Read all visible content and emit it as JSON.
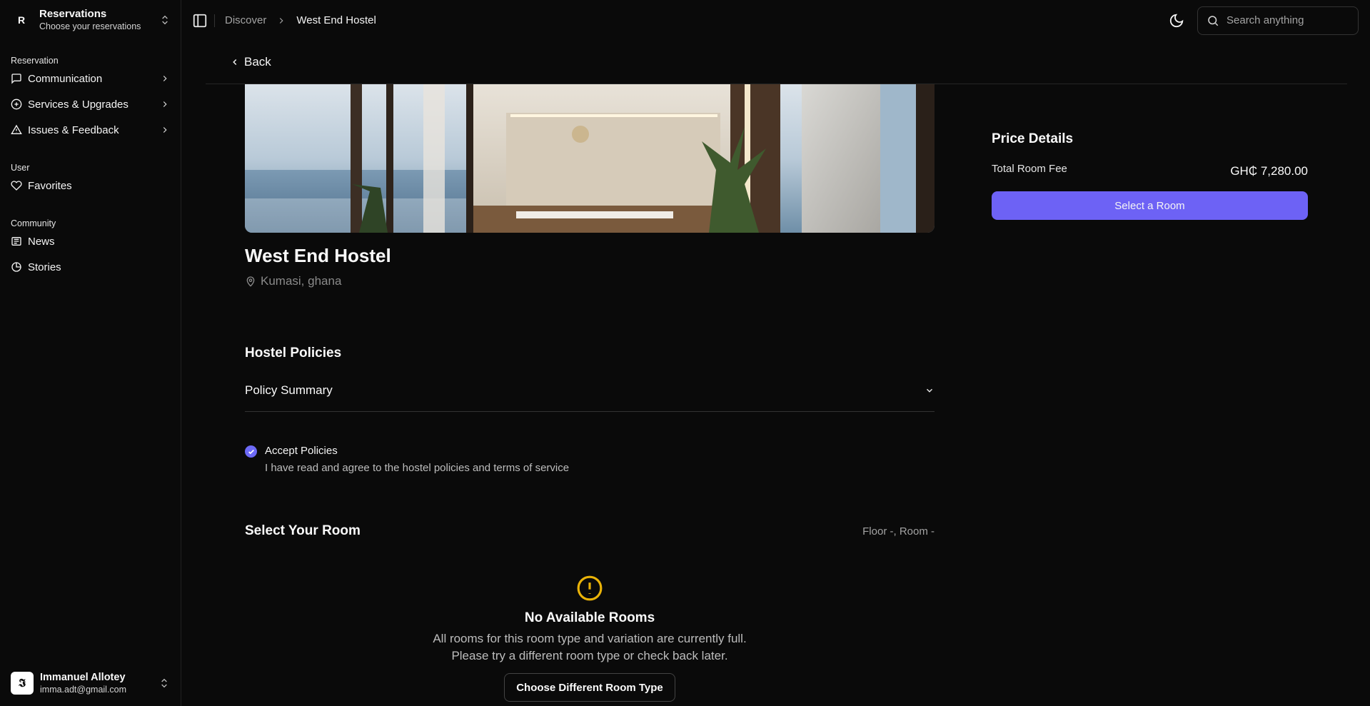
{
  "team": {
    "initial": "R",
    "name": "Reservations",
    "subtitle": "Choose your reservations"
  },
  "sidebar": {
    "reservation_label": "Reservation",
    "reservation_items": [
      {
        "label": "Communication",
        "icon": "message-square-icon"
      },
      {
        "label": "Services & Upgrades",
        "icon": "circle-plus-icon"
      },
      {
        "label": "Issues & Feedback",
        "icon": "alert-triangle-icon"
      }
    ],
    "user_label": "User",
    "user_items": [
      {
        "label": "Favorites",
        "icon": "heart-icon"
      }
    ],
    "community_label": "Community",
    "community_items": [
      {
        "label": "News",
        "icon": "newspaper-icon"
      },
      {
        "label": "Stories",
        "icon": "pie-chart-icon"
      }
    ]
  },
  "user": {
    "avatar_letter": "𝕴",
    "name": "Immanuel Allotey",
    "email": "imma.adt@gmail.com"
  },
  "breadcrumb": {
    "root": "Discover",
    "current": "West End Hostel"
  },
  "search": {
    "placeholder": "Search anything"
  },
  "back_label": "Back",
  "hostel": {
    "name": "West End Hostel",
    "location": "Kumasi, ghana"
  },
  "policies": {
    "heading": "Hostel Policies",
    "summary_label": "Policy Summary",
    "accept_title": "Accept Policies",
    "accept_text": "I have read and agree to the hostel policies and terms of service",
    "accepted": true
  },
  "room": {
    "heading": "Select Your Room",
    "floor_room": "Floor -, Room -",
    "empty_title": "No Available Rooms",
    "empty_line1": "All rooms for this room type and variation are currently full.",
    "empty_line2": "Please try a different room type or check back later.",
    "empty_button": "Choose Different Room Type"
  },
  "price": {
    "heading": "Price Details",
    "fee_label": "Total Room Fee",
    "fee_value": "GH₵ 7,280.00",
    "button": "Select a Room"
  },
  "colors": {
    "accent": "#6d62f5",
    "warning": "#eab308",
    "background": "#0a0a0a"
  }
}
